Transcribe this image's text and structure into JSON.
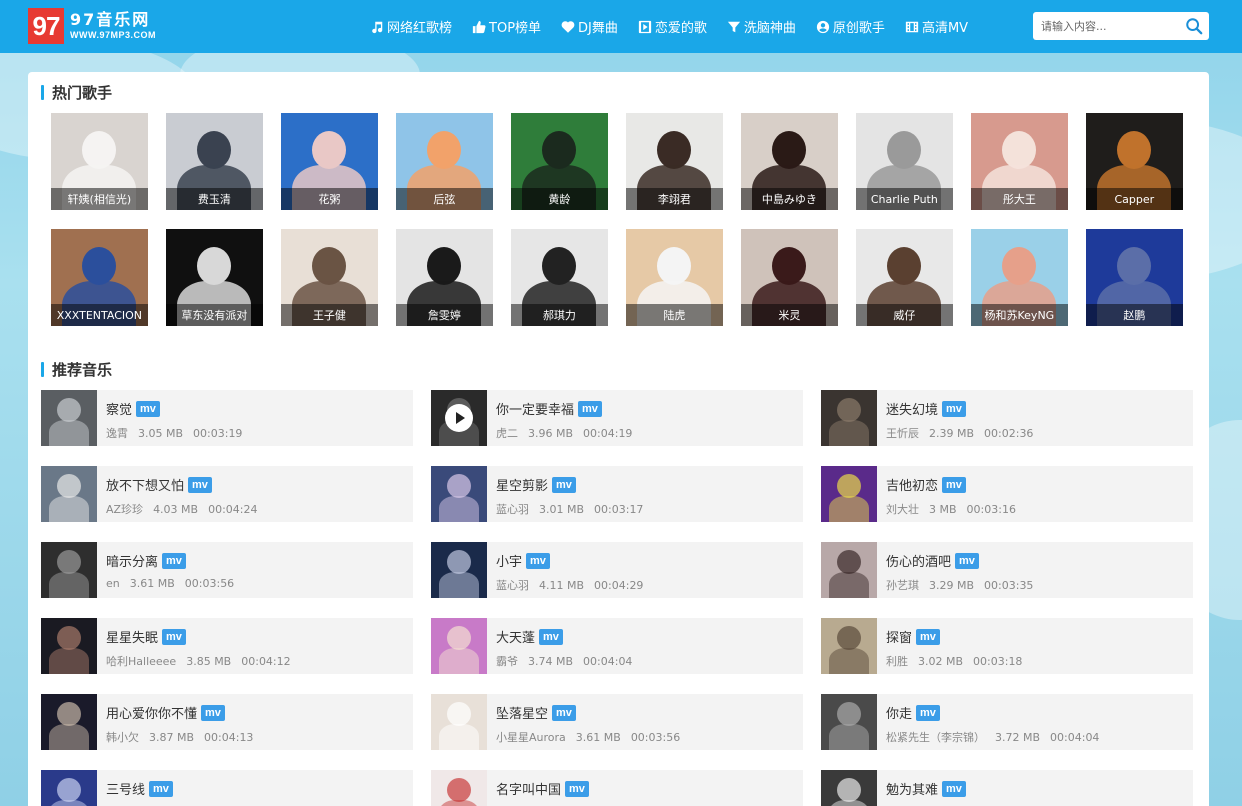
{
  "logo": {
    "digits": "97",
    "name_cn": "97音乐网",
    "domain": "WWW.97MP3.COM"
  },
  "nav": [
    {
      "label": "网络红歌榜",
      "icon": "music-note-icon"
    },
    {
      "label": "TOP榜单",
      "icon": "thumbs-up-icon"
    },
    {
      "label": "DJ舞曲",
      "icon": "heart-icon"
    },
    {
      "label": "恋爱的歌",
      "icon": "play-square-icon"
    },
    {
      "label": "洗脑神曲",
      "icon": "filter-icon"
    },
    {
      "label": "原创歌手",
      "icon": "user-circle-icon"
    },
    {
      "label": "高清MV",
      "icon": "film-icon"
    }
  ],
  "search": {
    "placeholder": "请输入内容..."
  },
  "sections": {
    "singers_title": "热门歌手",
    "songs_title": "推荐音乐"
  },
  "mv_badge": "mv",
  "singers": [
    [
      {
        "name": "轩姨(相信光)",
        "bg": "#d9d4d0",
        "fg": "#f5f3f2"
      },
      {
        "name": "费玉清",
        "bg": "#c9ccd2",
        "fg": "#3a4250"
      },
      {
        "name": "花粥",
        "bg": "#2c6fc8",
        "fg": "#e9c8c6"
      },
      {
        "name": "后弦",
        "bg": "#8fc4e8",
        "fg": "#f2a26a"
      },
      {
        "name": "黄龄",
        "bg": "#2f7d3a",
        "fg": "#1b2a1e"
      },
      {
        "name": "李翊君",
        "bg": "#e8e8e6",
        "fg": "#3a2b25"
      },
      {
        "name": "中島みゆき",
        "bg": "#d8cfc8",
        "fg": "#2a1a16"
      },
      {
        "name": "Charlie Puth",
        "bg": "#e4e4e4",
        "fg": "#9a9a9a"
      },
      {
        "name": "彤大王",
        "bg": "#d79a8e",
        "fg": "#f4e2da"
      },
      {
        "name": "Capper",
        "bg": "#1f1d1b",
        "fg": "#c0722c"
      }
    ],
    [
      {
        "name": "XXXTENTACION",
        "bg": "#a07050",
        "fg": "#2b4f9c"
      },
      {
        "name": "草东没有派对",
        "bg": "#101010",
        "fg": "#d8d8d8"
      },
      {
        "name": "王子健",
        "bg": "#e8dfd6",
        "fg": "#6a5444"
      },
      {
        "name": "詹雯婷",
        "bg": "#e4e4e4",
        "fg": "#1a1a1a"
      },
      {
        "name": "郝琪力",
        "bg": "#e6e6e6",
        "fg": "#222222"
      },
      {
        "name": "陆虎",
        "bg": "#e6c9a6",
        "fg": "#f4f4f4"
      },
      {
        "name": "米灵",
        "bg": "#cfc2ba",
        "fg": "#3a1a1a"
      },
      {
        "name": "威仔",
        "bg": "#e8e8e8",
        "fg": "#5a4030"
      },
      {
        "name": "杨和苏KeyNG",
        "bg": "#9ad0e8",
        "fg": "#e6a08a"
      },
      {
        "name": "赵鹏",
        "bg": "#1e3a9a",
        "fg": "#5b6ea8"
      }
    ]
  ],
  "songs": [
    [
      {
        "title": "察觉",
        "artist": "逸霄",
        "size": "3.05 MB",
        "duration": "00:03:19",
        "bg": "#5a5e62",
        "fg": "#c8ccd0"
      },
      {
        "title": "你一定要幸福",
        "artist": "虎二",
        "size": "3.96 MB",
        "duration": "00:04:19",
        "bg": "#2a2a2a",
        "fg": "#707070",
        "play": true
      },
      {
        "title": "迷失幻境",
        "artist": "王忻辰",
        "size": "2.39 MB",
        "duration": "00:02:36",
        "bg": "#3a3430",
        "fg": "#8a7a6a"
      }
    ],
    [
      {
        "title": "放不下想又怕",
        "artist": "AZ珍珍",
        "size": "4.03 MB",
        "duration": "00:04:24",
        "bg": "#6a7888",
        "fg": "#e8e8e8"
      },
      {
        "title": "星空剪影",
        "artist": "蓝心羽",
        "size": "3.01 MB",
        "duration": "00:03:17",
        "bg": "#3a4a7a",
        "fg": "#d8c8e8"
      },
      {
        "title": "吉他初恋",
        "artist": "刘大壮",
        "size": "3 MB",
        "duration": "00:03:16",
        "bg": "#5a2a8a",
        "fg": "#e8d84a"
      }
    ],
    [
      {
        "title": "暗示分离",
        "artist": "en",
        "size": "3.61 MB",
        "duration": "00:03:56",
        "bg": "#2e2e2e",
        "fg": "#9a9a9a"
      },
      {
        "title": "小宇",
        "artist": "蓝心羽",
        "size": "4.11 MB",
        "duration": "00:04:29",
        "bg": "#1a2a4a",
        "fg": "#c0c8e0"
      },
      {
        "title": "伤心的酒吧",
        "artist": "孙艺琪",
        "size": "3.29 MB",
        "duration": "00:03:35",
        "bg": "#b8a8a8",
        "fg": "#3a2a2a"
      }
    ],
    [
      {
        "title": "星星失眠",
        "artist": "哈利Halleeee",
        "size": "3.85 MB",
        "duration": "00:04:12",
        "bg": "#1a1a22",
        "fg": "#a87a6a"
      },
      {
        "title": "大天蓬",
        "artist": "霸爷",
        "size": "3.74 MB",
        "duration": "00:04:04",
        "bg": "#c87ac8",
        "fg": "#f4e0d0"
      },
      {
        "title": "探窗",
        "artist": "利胜",
        "size": "3.02 MB",
        "duration": "00:03:18",
        "bg": "#b8aa90",
        "fg": "#5a4a3a"
      }
    ],
    [
      {
        "title": "用心爱你你不懂",
        "artist": "韩小欠",
        "size": "3.87 MB",
        "duration": "00:04:13",
        "bg": "#1a1a2a",
        "fg": "#c8b8a8"
      },
      {
        "title": "坠落星空",
        "artist": "小星星Aurora",
        "size": "3.61 MB",
        "duration": "00:03:56",
        "bg": "#e8e0d8",
        "fg": "#ffffff"
      },
      {
        "title": "你走",
        "artist": "松紧先生（李宗锦）",
        "size": "3.72 MB",
        "duration": "00:04:04",
        "bg": "#4a4a4a",
        "fg": "#aaaaaa"
      }
    ],
    [
      {
        "title": "三号线",
        "artist": "",
        "size": "",
        "duration": "",
        "bg": "#2a3a8a",
        "fg": "#c8d0f0"
      },
      {
        "title": "名字叫中国",
        "artist": "",
        "size": "",
        "duration": "",
        "bg": "#f0e8e8",
        "fg": "#c83a3a"
      },
      {
        "title": "勉为其难",
        "artist": "",
        "size": "",
        "duration": "",
        "bg": "#3a3a3a",
        "fg": "#e8e8e8"
      }
    ]
  ]
}
